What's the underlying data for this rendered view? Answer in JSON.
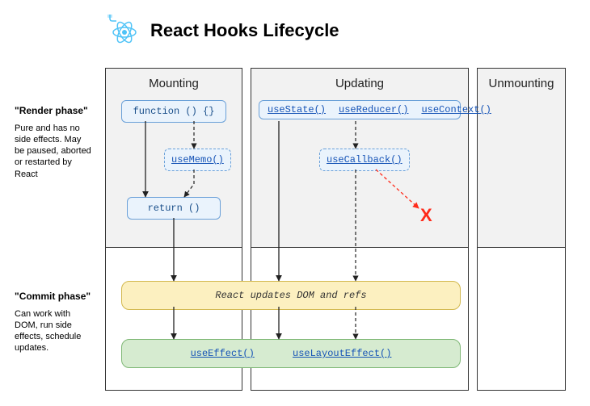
{
  "title": "React Hooks Lifecycle",
  "phases": {
    "render": {
      "header": "\"Render phase\"",
      "desc": "Pure and has no side effects. May be paused, aborted or restarted by React"
    },
    "commit": {
      "header": "\"Commit phase\"",
      "desc": "Can work with DOM, run side effects, schedule updates."
    }
  },
  "columns": {
    "mounting": "Mounting",
    "updating": "Updating",
    "unmounting": "Unmounting"
  },
  "nodes": {
    "function_decl": "function () {}",
    "useMemo": "useMemo()",
    "return_stmt": "return ()",
    "useState": "useState()",
    "useReducer": "useReducer()",
    "useContext": "useContext()",
    "useCallback": "useCallback()",
    "x_mark": "X",
    "dom_update": "React updates DOM and refs",
    "useEffect": "useEffect()",
    "useLayoutEffect": "useLayoutEffect()"
  }
}
